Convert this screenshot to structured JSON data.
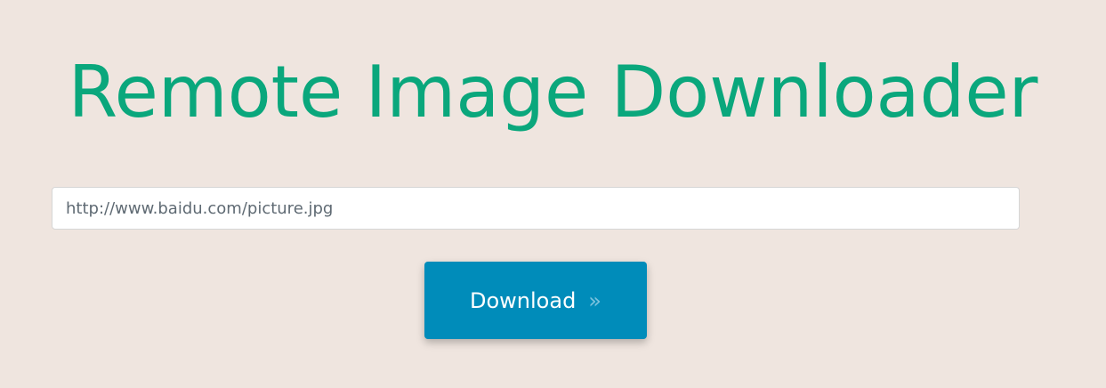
{
  "page": {
    "title": "Remote Image Downloader"
  },
  "form": {
    "url_placeholder": "http://www.baidu.com/picture.jpg",
    "url_value": "",
    "download_label": "Download",
    "download_icon": "double-chevron-right-icon",
    "download_icon_glyph": "»"
  },
  "colors": {
    "background": "#efe5df",
    "title": "#0aa77c",
    "button": "#008cba",
    "button_text": "#ffffff"
  }
}
